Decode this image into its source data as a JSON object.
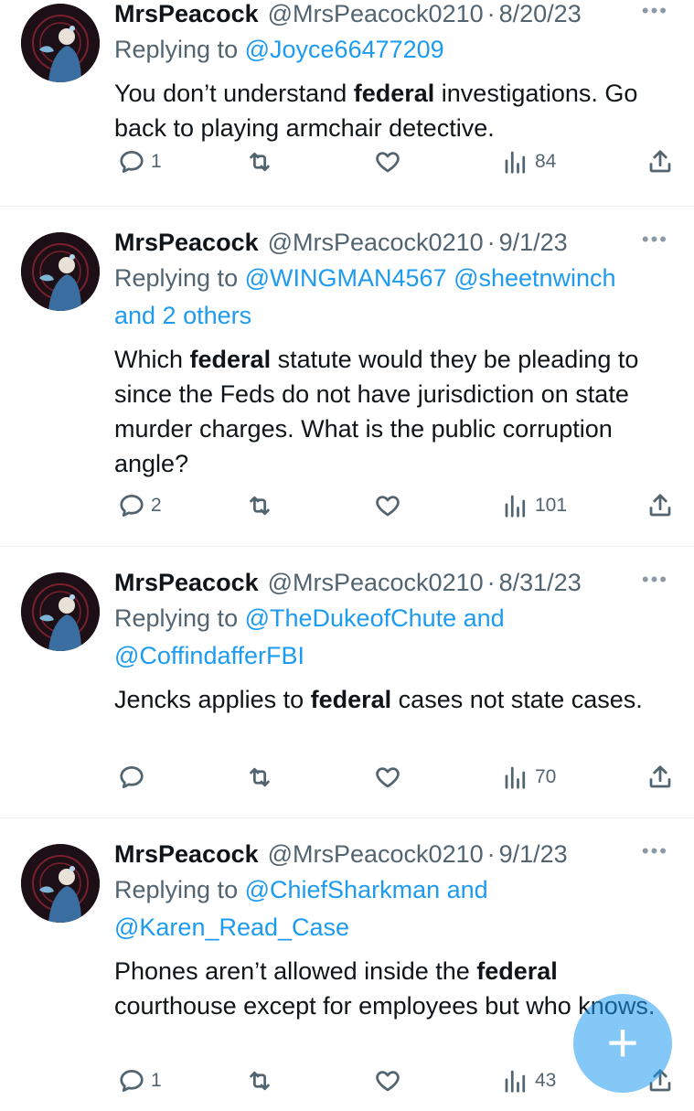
{
  "tweets": [
    {
      "name": "MrsPeacock",
      "handle": "@MrsPeacock0210",
      "date": "8/20/23",
      "replying_label": "Replying to",
      "replying_to": "@Joyce66477209",
      "replying_to_2": "",
      "text_before": "You don’t understand ",
      "text_bold": "federal",
      "text_after": " investigations. Go back to playing armchair detective.",
      "replies": "1",
      "views": "84"
    },
    {
      "name": "MrsPeacock",
      "handle": "@MrsPeacock0210",
      "date": "9/1/23",
      "replying_label": "Replying to",
      "replying_to": "@WINGMAN4567 @sheetnwinch",
      "replying_to_2": "and 2 others",
      "text_before": "Which ",
      "text_bold": "federal",
      "text_after": " statute would they be pleading to since the Feds do not have jurisdiction on state murder charges. What is the public corruption angle?",
      "replies": "2",
      "views": "101"
    },
    {
      "name": "MrsPeacock",
      "handle": "@MrsPeacock0210",
      "date": "8/31/23",
      "replying_label": "Replying to",
      "replying_to": "@TheDukeofChute and",
      "replying_to_2": "@CoffindafferFBI",
      "text_before": "Jencks applies to ",
      "text_bold": "federal",
      "text_after": " cases not state cases.",
      "replies": "",
      "views": "70"
    },
    {
      "name": "MrsPeacock",
      "handle": "@MrsPeacock0210",
      "date": "9/1/23",
      "replying_label": "Replying to",
      "replying_to": "@ChiefSharkman and",
      "replying_to_2": "@Karen_Read_Case",
      "text_before": "Phones aren’t allowed inside the ",
      "text_bold": "federal",
      "text_after": " courthouse except for employees but who knows.",
      "replies": "1",
      "views": "43"
    }
  ],
  "separator": "·",
  "more_icon": "more-dots-icon",
  "fab_icon": "+",
  "avatar_text": "MRS PEACOCK",
  "colors": {
    "link": "#1d9bf0",
    "muted": "#536471",
    "text": "#0f1419",
    "fab": "#8ecdf7"
  }
}
